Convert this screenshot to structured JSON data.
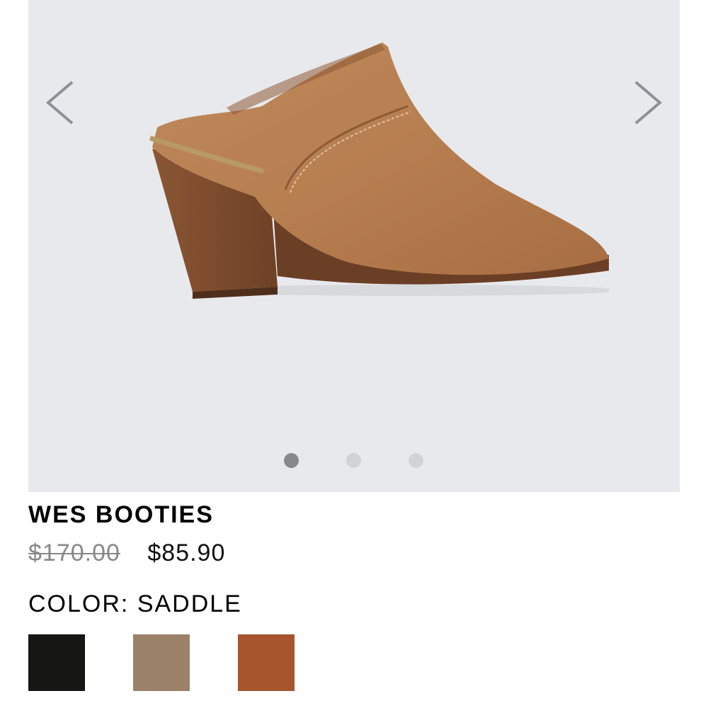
{
  "gallery": {
    "image_count": 3,
    "active_index": 0,
    "prev_icon": "chevron-left-icon",
    "next_icon": "chevron-right-icon",
    "background": "#e8e9ec"
  },
  "product": {
    "name": "WES BOOTIES",
    "original_price": "$170.00",
    "sale_price": "$85.90"
  },
  "color": {
    "label": "COLOR:",
    "selected": "SADDLE",
    "swatches": [
      {
        "color": "#161614"
      },
      {
        "color": "#9c8169"
      },
      {
        "color": "#a6552d"
      }
    ]
  }
}
